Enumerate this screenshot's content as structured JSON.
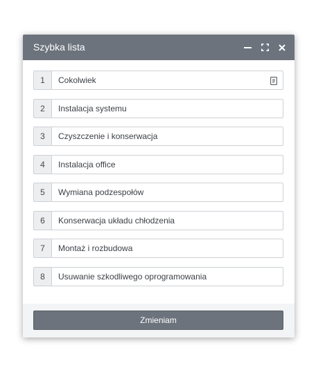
{
  "dialog": {
    "title": "Szybka lista",
    "icons": [
      "minimize-icon",
      "maximize-icon",
      "close-icon"
    ]
  },
  "list": {
    "items": [
      {
        "num": "1",
        "label": "Cokolwiek"
      },
      {
        "num": "2",
        "label": "Instalacja systemu"
      },
      {
        "num": "3",
        "label": "Czyszczenie i konserwacja"
      },
      {
        "num": "4",
        "label": "Instalacja office"
      },
      {
        "num": "5",
        "label": "Wymiana podzespołów"
      },
      {
        "num": "6",
        "label": "Konserwacja układu chłodzenia"
      },
      {
        "num": "7",
        "label": "Montaż i rozbudowa"
      },
      {
        "num": "8",
        "label": "Usuwanie szkodliwego oprogramowania"
      }
    ],
    "first_item_icon": "document-icon"
  },
  "footer": {
    "submit_label": "Zmieniam"
  },
  "colors": {
    "titlebar": "#6c737c",
    "button": "#6c737c",
    "border": "#cdd1d5",
    "number_bg": "#eceef0"
  }
}
